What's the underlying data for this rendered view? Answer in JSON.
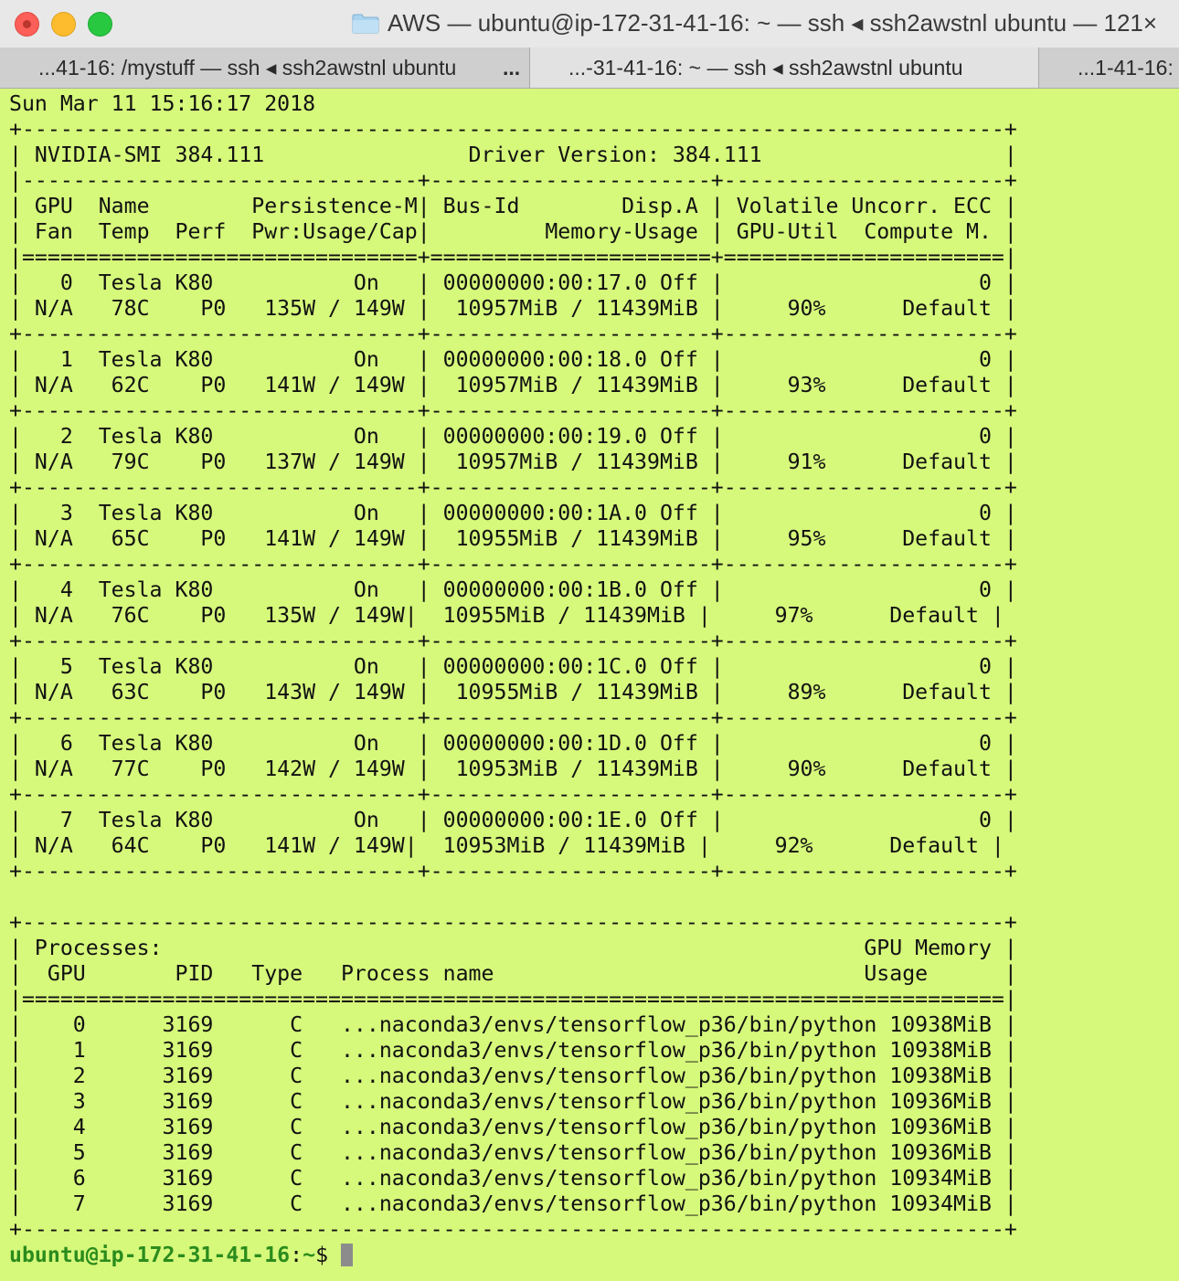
{
  "window": {
    "title": "AWS — ubuntu@ip-172-31-41-16: ~ — ssh ◂ ssh2awstnl ubuntu — 121×"
  },
  "tabs": [
    {
      "label": "...41-16: /mystuff — ssh ◂ ssh2awstnl ubuntu",
      "active": false
    },
    {
      "label": "...-31-41-16: ~ — ssh ◂ ssh2awstnl ubuntu",
      "active": true
    },
    {
      "label": "...1-41-16:",
      "active": false
    }
  ],
  "tab_overflow": "...",
  "terminal": {
    "output": "Sun Mar 11 15:16:17 2018\n+-----------------------------------------------------------------------------+\n| NVIDIA-SMI 384.111                Driver Version: 384.111                   |\n|-------------------------------+----------------------+----------------------+\n| GPU  Name        Persistence-M| Bus-Id        Disp.A | Volatile Uncorr. ECC |\n| Fan  Temp  Perf  Pwr:Usage/Cap|         Memory-Usage | GPU-Util  Compute M. |\n|===============================+======================+======================|\n|   0  Tesla K80           On   | 00000000:00:17.0 Off |                    0 |\n| N/A   78C    P0   135W / 149W |  10957MiB / 11439MiB |     90%      Default |\n+-------------------------------+----------------------+----------------------+\n|   1  Tesla K80           On   | 00000000:00:18.0 Off |                    0 |\n| N/A   62C    P0   141W / 149W |  10957MiB / 11439MiB |     93%      Default |\n+-------------------------------+----------------------+----------------------+\n|   2  Tesla K80           On   | 00000000:00:19.0 Off |                    0 |\n| N/A   79C    P0   137W / 149W |  10957MiB / 11439MiB |     91%      Default |\n+-------------------------------+----------------------+----------------------+\n|   3  Tesla K80           On   | 00000000:00:1A.0 Off |                    0 |\n| N/A   65C    P0   141W / 149W |  10955MiB / 11439MiB |     95%      Default |\n+-------------------------------+----------------------+----------------------+\n|   4  Tesla K80           On   | 00000000:00:1B.0 Off |                    0 |\n| N/A   76C    P0   135W / 149W|  10955MiB / 11439MiB |     97%      Default |\n+-------------------------------+----------------------+----------------------+\n|   5  Tesla K80           On   | 00000000:00:1C.0 Off |                    0 |\n| N/A   63C    P0   143W / 149W |  10955MiB / 11439MiB |     89%      Default |\n+-------------------------------+----------------------+----------------------+\n|   6  Tesla K80           On   | 00000000:00:1D.0 Off |                    0 |\n| N/A   77C    P0   142W / 149W |  10953MiB / 11439MiB |     90%      Default |\n+-------------------------------+----------------------+----------------------+\n|   7  Tesla K80           On   | 00000000:00:1E.0 Off |                    0 |\n| N/A   64C    P0   141W / 149W|  10953MiB / 11439MiB |     92%      Default |\n+-------------------------------+----------------------+----------------------+\n\n+-----------------------------------------------------------------------------+\n| Processes:                                                       GPU Memory |\n|  GPU       PID   Type   Process name                             Usage      |\n|=============================================================================|\n|    0      3169      C   ...naconda3/envs/tensorflow_p36/bin/python 10938MiB |\n|    1      3169      C   ...naconda3/envs/tensorflow_p36/bin/python 10938MiB |\n|    2      3169      C   ...naconda3/envs/tensorflow_p36/bin/python 10938MiB |\n|    3      3169      C   ...naconda3/envs/tensorflow_p36/bin/python 10936MiB |\n|    4      3169      C   ...naconda3/envs/tensorflow_p36/bin/python 10936MiB |\n|    5      3169      C   ...naconda3/envs/tensorflow_p36/bin/python 10936MiB |\n|    6      3169      C   ...naconda3/envs/tensorflow_p36/bin/python 10934MiB |\n|    7      3169      C   ...naconda3/envs/tensorflow_p36/bin/python 10934MiB |\n+-----------------------------------------------------------------------------+",
    "prompt_user": "ubuntu@ip-172-31-41-16",
    "prompt_sep": ":",
    "prompt_path": "~",
    "prompt_symbol": "$ "
  },
  "colors": {
    "terminal_bg": "#d6f87b",
    "prompt_user": "#2a8c1c"
  },
  "icons": {
    "close": "close-button",
    "minimize": "minimize-button",
    "maximize": "maximize-button",
    "title": "folder-icon"
  }
}
